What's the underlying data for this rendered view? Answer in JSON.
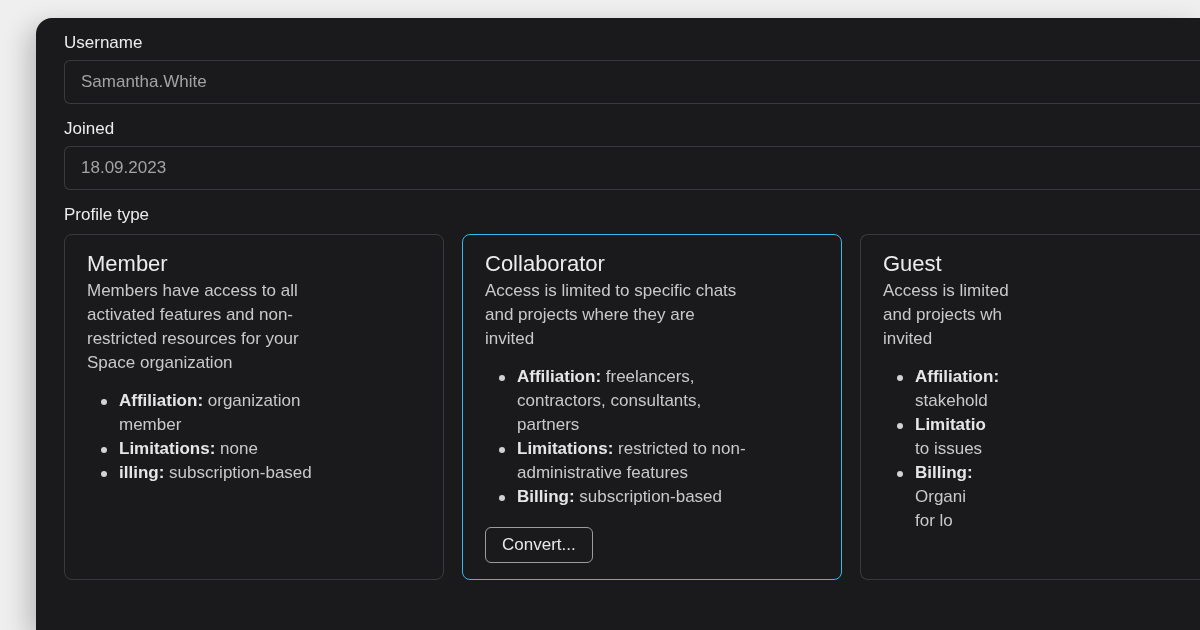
{
  "fields": [
    {
      "label": "Username",
      "value": "Samantha.White"
    },
    {
      "label": "Joined",
      "value": "18.09.2023"
    }
  ],
  "profile_type": {
    "label": "Profile type",
    "options": [
      {
        "title": "Member",
        "selected": false,
        "description": [
          "Members have access to all",
          "activated features and non-",
          "restricted resources for your",
          "Space organization"
        ],
        "bullets": [
          [
            "**Affiliation:** organization",
            "member"
          ],
          [
            "**Limitations:** none"
          ],
          [
            "**illing:** subscription-based"
          ]
        ]
      },
      {
        "title": "Collaborator",
        "selected": true,
        "description": [
          "Access is limited to specific chats",
          "and projects where they are",
          "invited"
        ],
        "bullets": [
          [
            "**Affiliation:** freelancers,",
            "contractors, consultants,",
            "partners"
          ],
          [
            "**Limitations:** restricted to non-",
            "administrative features"
          ],
          [
            "**Billing:** subscription-based"
          ]
        ],
        "button": "Convert..."
      },
      {
        "title": "Guest",
        "selected": false,
        "description": [
          "Access is limited",
          "and projects wh",
          "invited"
        ],
        "bullets": [
          [
            "**Affiliation:**",
            "stakehold"
          ],
          [
            "**Limitatio**",
            "to issues"
          ],
          [
            "**Billing:**",
            "Organi",
            "for lo"
          ]
        ]
      }
    ]
  }
}
